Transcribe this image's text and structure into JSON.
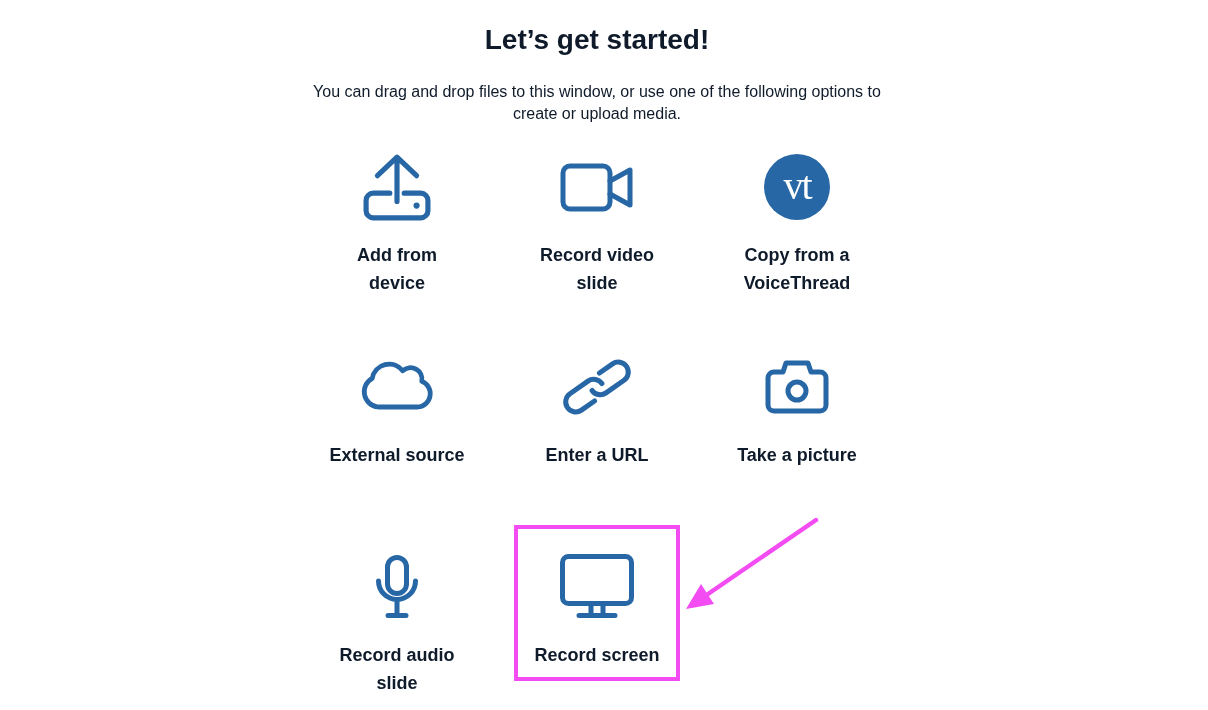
{
  "title": "Let’s get started!",
  "subtitle": "You can drag and drop files to this window, or use one of the following options to create or upload media.",
  "options": [
    {
      "kind": "device",
      "label": "Add from device",
      "highlighted": false
    },
    {
      "kind": "video",
      "label": "Record video slide",
      "highlighted": false
    },
    {
      "kind": "voicethread",
      "label": "Copy from a VoiceThread",
      "logo_text": "vt",
      "highlighted": false
    },
    {
      "kind": "external",
      "label": "External source",
      "highlighted": false
    },
    {
      "kind": "url",
      "label": "Enter a URL",
      "highlighted": false
    },
    {
      "kind": "picture",
      "label": "Take a picture",
      "highlighted": false
    },
    {
      "kind": "audio",
      "label": "Record audio slide",
      "highlighted": false
    },
    {
      "kind": "screen",
      "label": "Record screen",
      "highlighted": true
    }
  ]
}
